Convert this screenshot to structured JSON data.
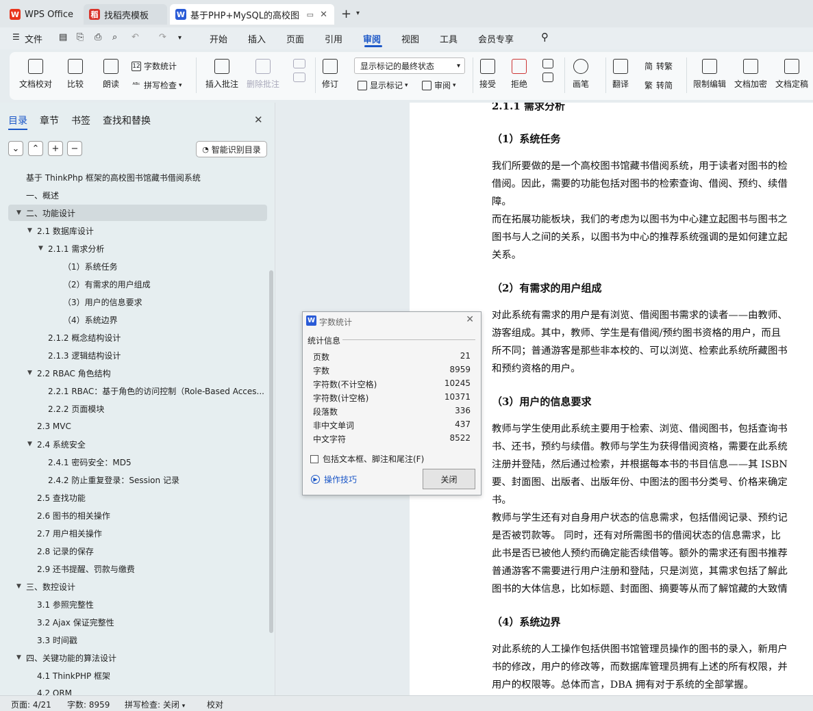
{
  "tabs": [
    {
      "label": "WPS Office",
      "icon": "wps-logo-icon"
    },
    {
      "label": "找稻壳模板",
      "icon": "docer-icon"
    },
    {
      "label": "基于PHP+MySQL的高校图书",
      "icon": "word-doc-icon"
    }
  ],
  "menu": {
    "file": "文件",
    "items": [
      "开始",
      "插入",
      "页面",
      "引用",
      "审阅",
      "视图",
      "工具",
      "会员专享"
    ],
    "active": "审阅"
  },
  "ribbon": {
    "doc_check": "文档校对",
    "compare": "比较",
    "read_aloud": "朗读",
    "word_count": "字数统计",
    "spell_check": "拼写检查",
    "insert_comment": "插入批注",
    "delete_comment": "删除批注",
    "revise": "修订",
    "markup_state": "显示标记的最终状态",
    "show_markup": "显示标记",
    "review": "审阅",
    "accept": "接受",
    "reject": "拒绝",
    "pen": "画笔",
    "translate": "翻译",
    "to_traditional": "转繁",
    "to_simplified": "转简",
    "restrict_edit": "限制编辑",
    "encrypt": "文档加密",
    "finalize": "文档定稿"
  },
  "sidebar": {
    "tabs": [
      "目录",
      "章节",
      "书签",
      "查找和替换"
    ],
    "smart_toc": "智能识别目录",
    "toc": [
      {
        "label": "基于 ThinkPhp 框架的高校图书馆藏书借阅系统",
        "level": 0,
        "arrow": ""
      },
      {
        "label": "一、概述",
        "level": 0,
        "arrow": ""
      },
      {
        "label": "二、功能设计",
        "level": 0,
        "arrow": "▼",
        "selected": true
      },
      {
        "label": "2.1  数据库设计",
        "level": 1,
        "arrow": "▼"
      },
      {
        "label": "2.1.1  需求分析",
        "level": 2,
        "arrow": "▼"
      },
      {
        "label": "（1）系统任务",
        "level": 3,
        "arrow": ""
      },
      {
        "label": "（2）有需求的用户组成",
        "level": 3,
        "arrow": ""
      },
      {
        "label": "（3）用户的信息要求",
        "level": 3,
        "arrow": ""
      },
      {
        "label": "（4）系统边界",
        "level": 3,
        "arrow": ""
      },
      {
        "label": "2.1.2  概念结构设计",
        "level": 2,
        "arrow": ""
      },
      {
        "label": "2.1.3  逻辑结构设计",
        "level": 2,
        "arrow": ""
      },
      {
        "label": "2.2 RBAC 角色结构",
        "level": 1,
        "arrow": "▼"
      },
      {
        "label": "2.2.1 RBAC：基于角色的访问控制（Role-Based Acces...",
        "level": 2,
        "arrow": ""
      },
      {
        "label": "2.2.2  页面模块",
        "level": 2,
        "arrow": ""
      },
      {
        "label": "2.3 MVC",
        "level": 1,
        "arrow": ""
      },
      {
        "label": "2.4  系统安全",
        "level": 1,
        "arrow": "▼"
      },
      {
        "label": "2.4.1  密码安全：MD5",
        "level": 2,
        "arrow": ""
      },
      {
        "label": "2.4.2  防止重复登录：Session 记录",
        "level": 2,
        "arrow": ""
      },
      {
        "label": "2.5  查找功能",
        "level": 1,
        "arrow": ""
      },
      {
        "label": "2.6  图书的相关操作",
        "level": 1,
        "arrow": ""
      },
      {
        "label": "2.7  用户相关操作",
        "level": 1,
        "arrow": ""
      },
      {
        "label": "2.8  记录的保存",
        "level": 1,
        "arrow": ""
      },
      {
        "label": "2.9  还书提醒、罚款与缴费",
        "level": 1,
        "arrow": ""
      },
      {
        "label": "三、数控设计",
        "level": 0,
        "arrow": "▼"
      },
      {
        "label": "3.1  参照完整性",
        "level": 1,
        "arrow": ""
      },
      {
        "label": "3.2 Ajax 保证完整性",
        "level": 1,
        "arrow": ""
      },
      {
        "label": "3.3  时间戳",
        "level": 1,
        "arrow": ""
      },
      {
        "label": "四、关键功能的算法设计",
        "level": 0,
        "arrow": "▼"
      },
      {
        "label": "4.1 ThinkPHP 框架",
        "level": 1,
        "arrow": ""
      },
      {
        "label": "4.2 ORM",
        "level": 1,
        "arrow": ""
      }
    ]
  },
  "document": {
    "lines": [
      {
        "kind": "h3",
        "text": "2.1.1  需求分析"
      },
      {
        "kind": "h4",
        "text": "（1）系统任务"
      },
      {
        "kind": "p",
        "text": "我们所要做的是一个高校图书馆藏书借阅系统，用于读者对图书的检"
      },
      {
        "kind": "p",
        "text": "借阅。因此，需要的功能包括对图书的检索查询、借阅、预约、续借"
      },
      {
        "kind": "p",
        "text": "障。"
      },
      {
        "kind": "p",
        "text": "而在拓展功能板块，我们的考虑为以图书为中心建立起图书与图书之"
      },
      {
        "kind": "p",
        "text": "图书与人之间的关系，以图书为中心的推荐系统强调的是如何建立起"
      },
      {
        "kind": "p",
        "text": "关系。"
      },
      {
        "kind": "h4",
        "text": "（2）有需求的用户组成"
      },
      {
        "kind": "p",
        "text": "对此系统有需求的用户是有浏览、借阅图书需求的读者——由教师、"
      },
      {
        "kind": "p",
        "text": "游客组成。其中，教师、学生是有借阅/预约图书资格的用户，而且"
      },
      {
        "kind": "p",
        "text": "所不同；普通游客是那些非本校的、可以浏览、检索此系统所藏图书"
      },
      {
        "kind": "p",
        "text": "和预约资格的用户。"
      },
      {
        "kind": "h4",
        "text": "（3）用户的信息要求"
      },
      {
        "kind": "p",
        "text": "教师与学生使用此系统主要用于检索、浏览、借阅图书，包括查询书"
      },
      {
        "kind": "p",
        "text": "书、还书，预约与续借。教师与学生为获得借阅资格，需要在此系统"
      },
      {
        "kind": "p",
        "text": "注册并登陆，然后通过检索，并根据每本书的书目信息——其 ISBN"
      },
      {
        "kind": "p",
        "text": "要、封面图、出版者、出版年份、中图法的图书分类号、价格来确定"
      },
      {
        "kind": "p",
        "text": "书。"
      },
      {
        "kind": "p",
        "text": "教师与学生还有对自身用户状态的信息需求，包括借阅记录、预约记"
      },
      {
        "kind": "p",
        "text": "是否被罚款等。  同时，还有对所需图书的借阅状态的信息需求，比"
      },
      {
        "kind": "p",
        "text": "此书是否已被他人预约而确定能否续借等。额外的需求还有图书推荐"
      },
      {
        "kind": "p",
        "text": "普通游客不需要进行用户注册和登陆，只是浏览，其需求包括了解此"
      },
      {
        "kind": "p",
        "text": "图书的大体信息，比如标题、封面图、摘要等从而了解馆藏的大致情"
      },
      {
        "kind": "h4",
        "text": "（4）系统边界"
      },
      {
        "kind": "p",
        "text": "对此系统的人工操作包括供图书馆管理员操作的图书的录入，新用户"
      },
      {
        "kind": "p",
        "text": "书的修改，用户的修改等，而数据库管理员拥有上述的所有权限，并"
      },
      {
        "kind": "p",
        "text": "用户的权限等。总体而言，DBA 拥有对于系统的全部掌握。"
      },
      {
        "kind": "h3",
        "text": "2.1.2  概念结构设计"
      }
    ]
  },
  "dialog": {
    "title": "字数统计",
    "section": "统计信息",
    "rows": [
      {
        "label": "页数",
        "value": "21"
      },
      {
        "label": "字数",
        "value": "8959"
      },
      {
        "label": "字符数(不计空格)",
        "value": "10245"
      },
      {
        "label": "字符数(计空格)",
        "value": "10371"
      },
      {
        "label": "段落数",
        "value": "336"
      },
      {
        "label": "非中文单词",
        "value": "437"
      },
      {
        "label": "中文字符",
        "value": "8522"
      }
    ],
    "checkbox": "包括文本框、脚注和尾注(F)",
    "tips": "操作技巧",
    "close": "关闭"
  },
  "status": {
    "page": "页面: 4/21",
    "words": "字数: 8959",
    "spell": "拼写检查: 关闭",
    "proof": "校对"
  }
}
